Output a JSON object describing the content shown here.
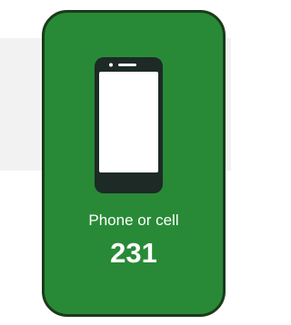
{
  "card": {
    "label": "Phone or cell",
    "count": "231",
    "icon": "smartphone-icon"
  },
  "colors": {
    "card_background": "#288a36",
    "card_border": "#1c3a1c",
    "backdrop": "#f2f2f2",
    "text": "#ffffff"
  }
}
